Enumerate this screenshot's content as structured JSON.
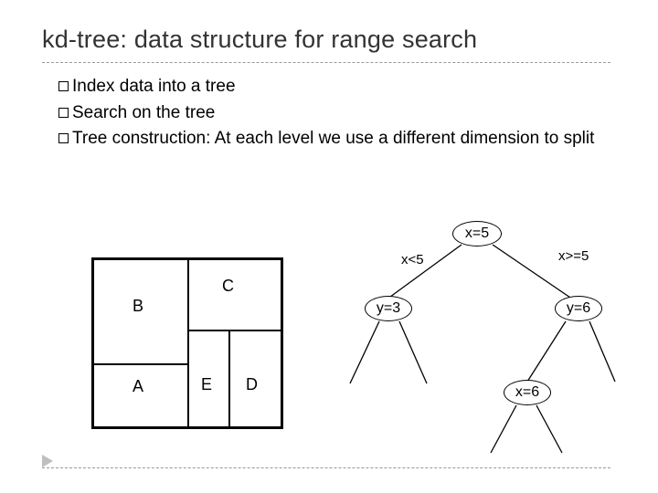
{
  "title": "kd-tree: data structure for range search",
  "bullets": [
    "Index data into a tree",
    "Search on the tree",
    "Tree construction: At each level we use a different dimension to split"
  ],
  "regions": {
    "A": "A",
    "B": "B",
    "C": "C",
    "D": "D",
    "E": "E"
  },
  "tree": {
    "root": "x=5",
    "edge_left": "x<5",
    "edge_right": "x>=5",
    "left": "y=3",
    "right": "y=6",
    "right_left": "x=6"
  }
}
